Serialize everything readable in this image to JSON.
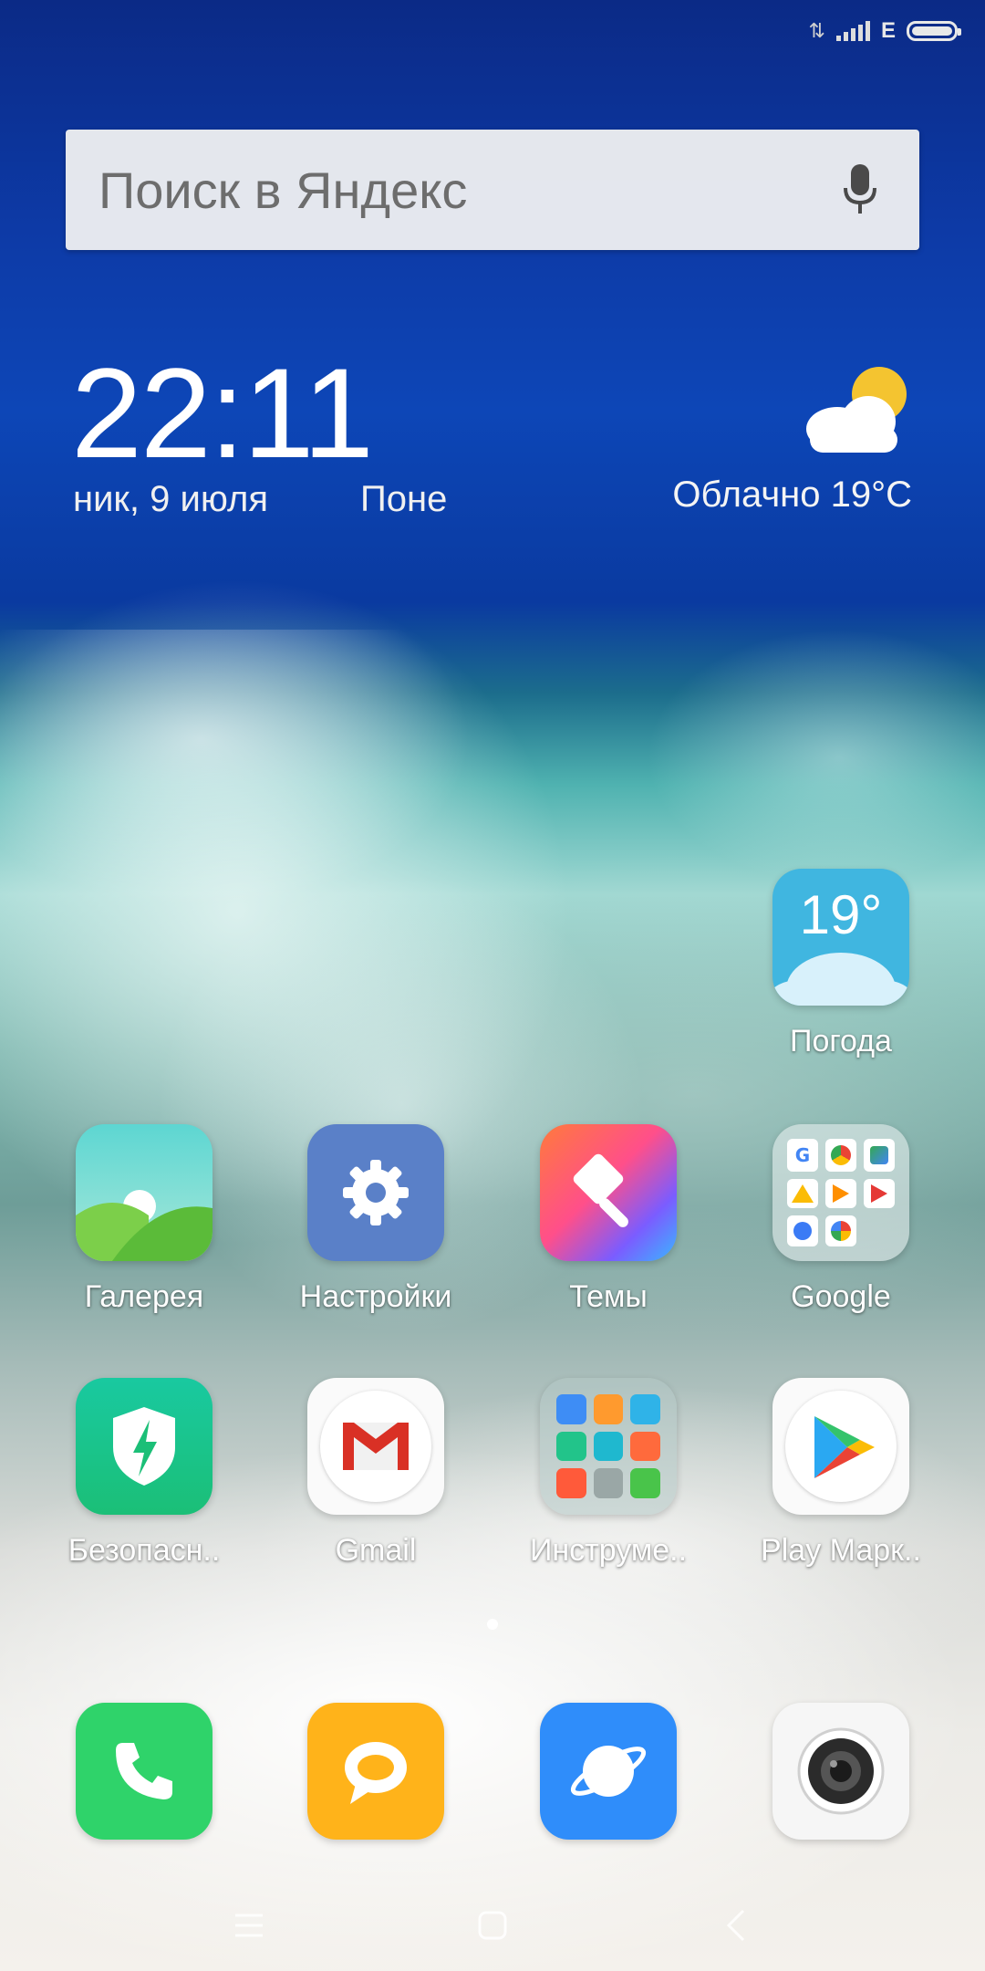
{
  "status_bar": {
    "network": "E",
    "data_arrows": "⇅"
  },
  "search": {
    "placeholder": "Поиск в Яндекс"
  },
  "clock_widget": {
    "time": "22:11",
    "date": "ник, 9 июля",
    "day": "Поне",
    "weather": "Облачно  19°C"
  },
  "apps": {
    "weather": {
      "label": "Погода",
      "temp": "19°"
    },
    "gallery": {
      "label": "Галерея"
    },
    "settings": {
      "label": "Настройки"
    },
    "themes": {
      "label": "Темы"
    },
    "google": {
      "label": "Google"
    },
    "security": {
      "label": "Безопасн.."
    },
    "gmail": {
      "label": "Gmail"
    },
    "tools": {
      "label": "Инструме.."
    },
    "play": {
      "label": "Play Марк.."
    }
  },
  "dock": [
    "phone",
    "messages",
    "browser",
    "camera"
  ],
  "colors": {
    "phone": "#2fd36a",
    "messages": "#ffb31a",
    "browser": "#2f8dfa",
    "settings": "#5a80c8",
    "security": "#1fc88a",
    "weather_tile": "#40b6e0"
  }
}
